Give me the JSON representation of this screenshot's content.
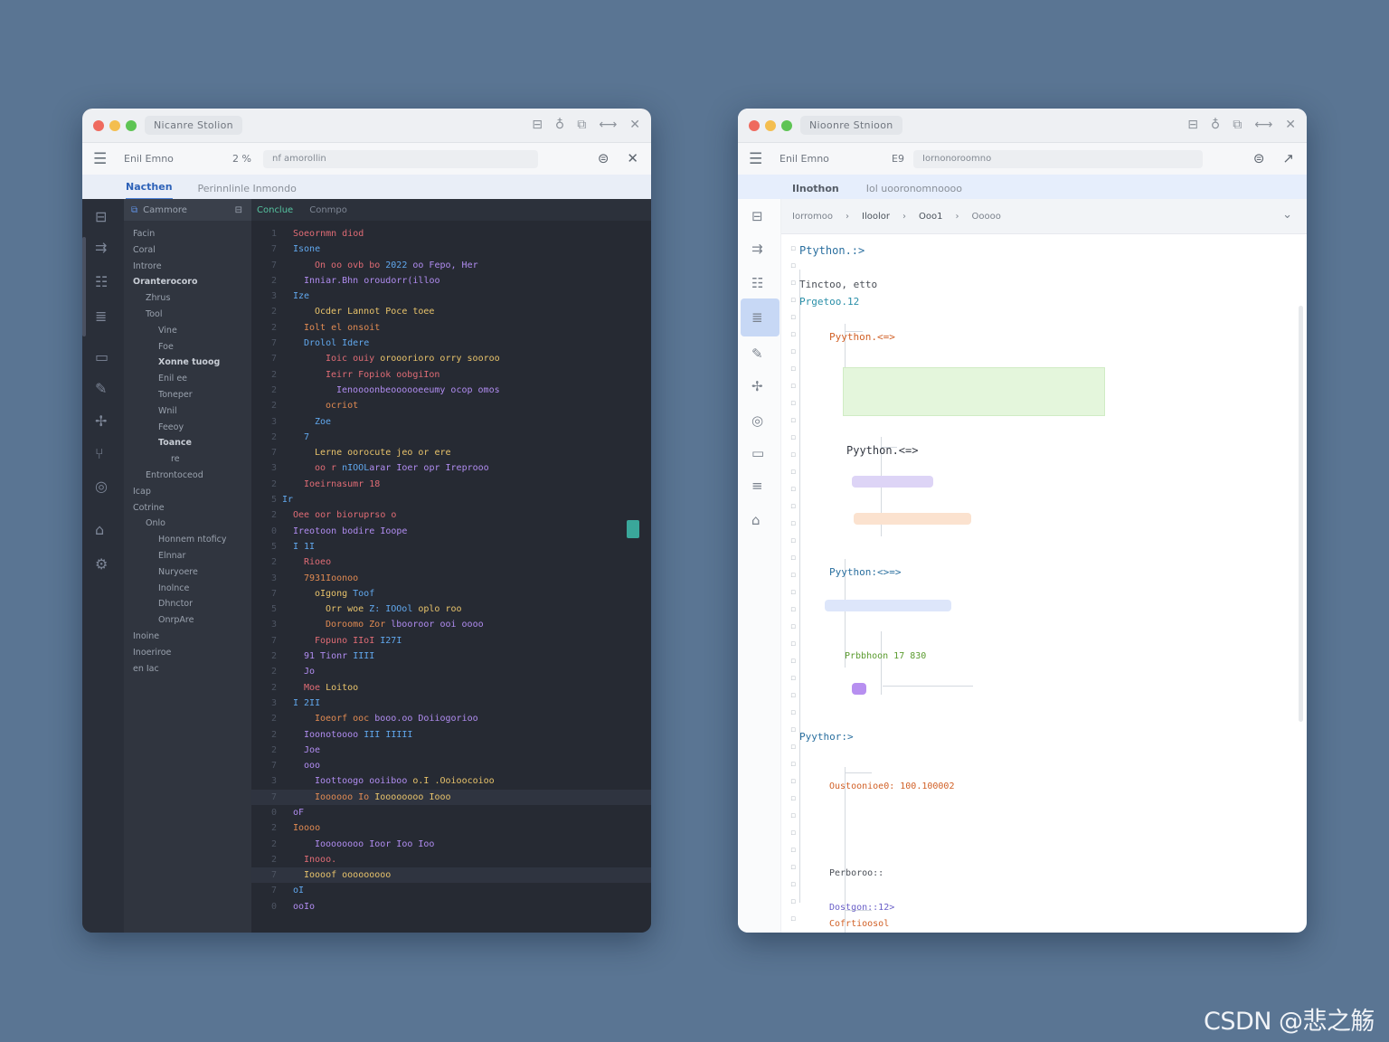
{
  "colors": {
    "background": "#5a7593",
    "dark_bg": "#262a33",
    "light_bg": "#ffffff",
    "accent": "#4a7fd4",
    "code_red": "#e06c75",
    "code_blue": "#61a8ee",
    "code_green": "#8fcf6a",
    "code_yellow": "#e8c36b",
    "code_purple": "#b08cf0",
    "code_orange": "#e08a52",
    "code_teal": "#5bc0b0"
  },
  "watermark": "CSDN @悲之觞",
  "dark": {
    "title": "Nicanre Stolion",
    "toolbar": {
      "left": "Enil Emno",
      "mid": "2 %",
      "address": "nf amorollin"
    },
    "subtabs": [
      "Nacthen",
      "Perinnlinle Inmondo"
    ],
    "sidebar": {
      "header": "Cammore",
      "items": [
        {
          "t": "Facin",
          "d": 0,
          "b": false
        },
        {
          "t": "Coral",
          "d": 0,
          "b": false
        },
        {
          "t": "Introre",
          "d": 0,
          "b": false
        },
        {
          "t": "Oranterocoro",
          "d": 0,
          "b": true
        },
        {
          "t": "Zhrus",
          "d": 1,
          "b": false
        },
        {
          "t": "Tool",
          "d": 1,
          "b": false
        },
        {
          "t": "Vine",
          "d": 2,
          "b": false
        },
        {
          "t": "Foe",
          "d": 2,
          "b": false
        },
        {
          "t": "Xonne tuoog",
          "d": 2,
          "b": true
        },
        {
          "t": "Enil ee",
          "d": 2,
          "b": false
        },
        {
          "t": "Toneper",
          "d": 2,
          "b": false
        },
        {
          "t": "Wnil",
          "d": 2,
          "b": false
        },
        {
          "t": "Feeoy",
          "d": 2,
          "b": false
        },
        {
          "t": "Toance",
          "d": 2,
          "b": true
        },
        {
          "t": "re",
          "d": 3,
          "b": false
        },
        {
          "t": "Entrontoceod",
          "d": 1,
          "b": false
        },
        {
          "t": "Icap",
          "d": 0,
          "b": false
        },
        {
          "t": "Cotrine",
          "d": 0,
          "b": false
        },
        {
          "t": "Onlo",
          "d": 1,
          "b": false
        },
        {
          "t": "Honnem ntoficy",
          "d": 2,
          "b": false
        },
        {
          "t": "Elnnar",
          "d": 2,
          "b": false
        },
        {
          "t": "Nuryoere",
          "d": 2,
          "b": false
        },
        {
          "t": "Inolnce",
          "d": 2,
          "b": false
        },
        {
          "t": "Dhnctor",
          "d": 2,
          "b": false
        },
        {
          "t": "OnrpAre",
          "d": 2,
          "b": false
        },
        {
          "t": "Inoine",
          "d": 0,
          "b": false
        },
        {
          "t": "Inoeriroe",
          "d": 0,
          "b": false
        },
        {
          "t": "en Iac",
          "d": 0,
          "b": false
        }
      ]
    },
    "editor_tabs": [
      "Conclue",
      "Conmpo"
    ],
    "code": [
      {
        "n": "1",
        "i": 1,
        "p": [
          {
            "t": "Soeornmn diod",
            "c": "code_red"
          }
        ]
      },
      {
        "n": "7",
        "i": 1,
        "p": [
          {
            "t": "Isone",
            "c": "code_blue"
          }
        ]
      },
      {
        "n": "7",
        "i": 3,
        "p": [
          {
            "t": "On oo ovb bo",
            "c": "code_red"
          },
          {
            "t": " 2022 ",
            "c": "code_blue"
          },
          {
            "t": "oo Fepo, Her",
            "c": "code_purple"
          }
        ]
      },
      {
        "n": "2",
        "i": 2,
        "p": [
          {
            "t": "Inniar.Bhn oroudorr(illoo",
            "c": "code_purple"
          }
        ]
      },
      {
        "n": "3",
        "i": 1,
        "p": [
          {
            "t": "Ize",
            "c": "code_blue"
          }
        ]
      },
      {
        "n": "2",
        "i": 3,
        "p": [
          {
            "t": "Ocder Lannot Poce toee",
            "c": "code_yellow"
          }
        ]
      },
      {
        "n": "2",
        "i": 2,
        "p": [
          {
            "t": "Iolt el onsoit",
            "c": "code_orange"
          }
        ]
      },
      {
        "n": "7",
        "i": 2,
        "p": [
          {
            "t": "Drolol Idere",
            "c": "code_blue"
          }
        ]
      },
      {
        "n": "7",
        "i": 4,
        "p": [
          {
            "t": "Ioic ouiy",
            "c": "code_red"
          },
          {
            "t": " orooorioro orry sooroo",
            "c": "code_yellow"
          }
        ]
      },
      {
        "n": "2",
        "i": 4,
        "p": [
          {
            "t": "Ieirr Fopiok oobgiIon",
            "c": "code_red"
          }
        ]
      },
      {
        "n": "2",
        "i": 5,
        "p": [
          {
            "t": "Ienoooonbeoooooeeumy ocop omos",
            "c": "code_purple"
          }
        ]
      },
      {
        "n": "2",
        "i": 4,
        "p": [
          {
            "t": "ocriot",
            "c": "code_orange"
          }
        ]
      },
      {
        "n": "3",
        "i": 3,
        "p": [
          {
            "t": "Zoe",
            "c": "code_blue"
          }
        ]
      },
      {
        "n": "2",
        "i": 2,
        "p": [
          {
            "t": "7",
            "c": "code_blue"
          }
        ]
      },
      {
        "n": "7",
        "i": 3,
        "p": [
          {
            "t": "Lerne oorocute jeo or ere",
            "c": "code_yellow"
          }
        ]
      },
      {
        "n": "3",
        "i": 3,
        "p": [
          {
            "t": "oo r",
            "c": "code_red"
          },
          {
            "t": " nIOOL",
            "c": "code_blue"
          },
          {
            "t": "arar Ioer opr Ireprooo",
            "c": "code_purple"
          }
        ]
      },
      {
        "n": "2",
        "i": 2,
        "p": [
          {
            "t": "Ioeirnasumr 18",
            "c": "code_red"
          }
        ]
      },
      {
        "n": "5",
        "i": 0,
        "p": [
          {
            "t": "Ir",
            "c": "code_blue"
          }
        ]
      },
      {
        "n": "2",
        "i": 1,
        "p": [
          {
            "t": "Oee oor bioruprso o",
            "c": "code_red"
          }
        ]
      },
      {
        "n": "0",
        "i": 1,
        "p": [
          {
            "t": "Ireotoon bodire Ioope",
            "c": "code_purple"
          }
        ]
      },
      {
        "n": "5",
        "i": 1,
        "p": [
          {
            "t": "I 1I",
            "c": "code_blue"
          }
        ]
      },
      {
        "n": "2",
        "i": 2,
        "p": [
          {
            "t": "Rioeo",
            "c": "code_red"
          }
        ]
      },
      {
        "n": "3",
        "i": 2,
        "p": [
          {
            "t": "7931Ioonoo",
            "c": "code_orange"
          }
        ]
      },
      {
        "n": "7",
        "i": 3,
        "p": [
          {
            "t": "oIgong",
            "c": "code_yellow"
          },
          {
            "t": " Toof",
            "c": "code_blue"
          }
        ]
      },
      {
        "n": "5",
        "i": 4,
        "p": [
          {
            "t": "Orr woe",
            "c": "code_yellow"
          },
          {
            "t": " Z: IOOol",
            "c": "code_blue"
          },
          {
            "t": " oplo roo",
            "c": "code_yellow"
          }
        ]
      },
      {
        "n": "3",
        "i": 4,
        "p": [
          {
            "t": "Doroomo Zor",
            "c": "code_orange"
          },
          {
            "t": " lbooroor ooi oooo",
            "c": "code_purple"
          }
        ]
      },
      {
        "n": "7",
        "i": 3,
        "p": [
          {
            "t": "Fopuno IIoI",
            "c": "code_red"
          },
          {
            "t": " I27I",
            "c": "code_blue"
          }
        ]
      },
      {
        "n": "2",
        "i": 2,
        "p": [
          {
            "t": "91 Tionr",
            "c": "code_purple"
          },
          {
            "t": " IIII",
            "c": "code_blue"
          }
        ]
      },
      {
        "n": "2",
        "i": 2,
        "p": [
          {
            "t": "Jo",
            "c": "code_purple"
          }
        ]
      },
      {
        "n": "2",
        "i": 2,
        "p": [
          {
            "t": "Moe",
            "c": "code_red"
          },
          {
            "t": " Loitoo",
            "c": "code_yellow"
          }
        ]
      },
      {
        "n": "3",
        "i": 1,
        "p": [
          {
            "t": "I 2II",
            "c": "code_blue"
          }
        ]
      },
      {
        "n": "2",
        "i": 3,
        "p": [
          {
            "t": "Ioeorf ooc",
            "c": "code_orange"
          },
          {
            "t": " booo.oo Doiiogorioo",
            "c": "code_purple"
          }
        ]
      },
      {
        "n": "2",
        "i": 2,
        "p": [
          {
            "t": "Ioonotoooo",
            "c": "code_purple"
          },
          {
            "t": " III IIIII",
            "c": "code_blue"
          }
        ]
      },
      {
        "n": "2",
        "i": 2,
        "p": [
          {
            "t": "Joe",
            "c": "code_purple"
          }
        ]
      },
      {
        "n": "7",
        "i": 2,
        "p": [
          {
            "t": "ooo",
            "c": "code_purple"
          }
        ]
      },
      {
        "n": "3",
        "i": 3,
        "p": [
          {
            "t": "Ioottoogo ooiiboo",
            "c": "code_purple"
          },
          {
            "t": " o.I .Ooioocoioo",
            "c": "code_yellow"
          }
        ]
      },
      {
        "n": "7",
        "i": 3,
        "p": [
          {
            "t": "Ioooooo Io",
            "c": "code_orange"
          },
          {
            "t": " Ioooooooo Iooo",
            "c": "code_yellow"
          }
        ],
        "hl": true
      },
      {
        "n": "0",
        "i": 1,
        "p": [
          {
            "t": "oF",
            "c": "code_purple"
          }
        ]
      },
      {
        "n": "2",
        "i": 1,
        "p": [
          {
            "t": "Ioooo",
            "c": "code_orange"
          }
        ]
      },
      {
        "n": "2",
        "i": 3,
        "p": [
          {
            "t": "Ioooooooo Ioor Ioo Ioo",
            "c": "code_purple"
          }
        ]
      },
      {
        "n": "2",
        "i": 2,
        "p": [
          {
            "t": "Inooo.",
            "c": "code_red"
          }
        ]
      },
      {
        "n": "7",
        "i": 2,
        "p": [
          {
            "t": "Ioooof ooooooooo",
            "c": "code_yellow"
          }
        ],
        "hl": true
      },
      {
        "n": "7",
        "i": 1,
        "p": [
          {
            "t": "oI",
            "c": "code_blue"
          }
        ]
      },
      {
        "n": "0",
        "i": 1,
        "p": [
          {
            "t": "ooIo",
            "c": "code_purple"
          }
        ]
      }
    ]
  },
  "light": {
    "title": "Nioonre Stnioon",
    "toolbar": {
      "left": "Enil Emno",
      "mid": "E9",
      "address": "Iornonoroomno"
    },
    "subtab": "Ilnothon",
    "subtab_hint": "Iol uooronomnoooo",
    "path": [
      "Iorromoo",
      "Iloolor",
      "Ooo1",
      "Ooooo"
    ],
    "nodes": [
      {
        "k": "n1",
        "t": "Ptython.:>",
        "c": "#2a6f9f"
      },
      {
        "k": "n2",
        "t": "Tinctoo, etto",
        "c": "#4a4f57"
      },
      {
        "k": "n3",
        "t": "Prgetoo.12",
        "c": "#2a8fa8"
      },
      {
        "k": "n4",
        "t": "Pyython.<=>",
        "c": "#d16026"
      },
      {
        "k": "n5",
        "t": "Pyython.<=>",
        "c": "#333842"
      },
      {
        "k": "n6",
        "t": "Pyython:<>=>",
        "c": "#2a6f9f"
      },
      {
        "k": "n7",
        "t": "Prbbhoon 17 830",
        "c": "#5a9b2e"
      },
      {
        "k": "n8",
        "t": "Pyythor:>",
        "c": "#2a6f9f"
      },
      {
        "k": "n9",
        "t": "Oustoonioe0: 100.100002",
        "c": "#d16026"
      },
      {
        "k": "n10",
        "t": "Perboroo::",
        "c": "#4a4f57"
      },
      {
        "k": "n11",
        "t": "Dostgon::12>",
        "c": "#6a5fc8"
      },
      {
        "k": "n12",
        "t": "Cofrtioosol",
        "c": "#d16026"
      }
    ]
  }
}
